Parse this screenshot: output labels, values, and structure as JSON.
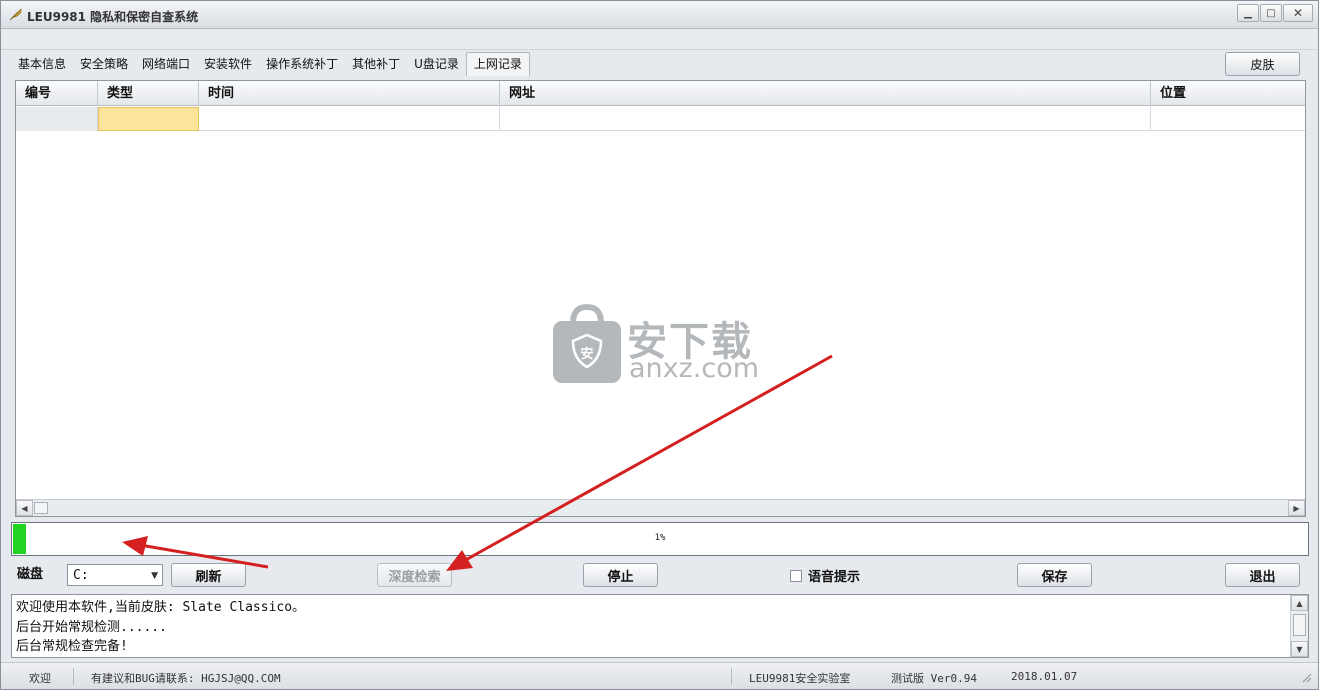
{
  "window": {
    "title": "LEU9981 隐私和保密自查系统",
    "controls": {
      "minimize": "▁",
      "maximize": "□",
      "close": "✕"
    }
  },
  "tabs": [
    {
      "label": "基本信息"
    },
    {
      "label": "安全策略"
    },
    {
      "label": "网络端口"
    },
    {
      "label": "安装软件"
    },
    {
      "label": "操作系统补丁"
    },
    {
      "label": "其他补丁"
    },
    {
      "label": "U盘记录"
    },
    {
      "label": "上网记录",
      "active": true
    }
  ],
  "skin_button": "皮肤",
  "table": {
    "columns": [
      "编号",
      "类型",
      "时间",
      "网址",
      "位置"
    ],
    "rows": [
      [
        "",
        "",
        "",
        "",
        ""
      ]
    ]
  },
  "watermark": {
    "cn": "安下载",
    "en": "anxz.com",
    "badge": "安"
  },
  "progress": {
    "value": 0.01,
    "label": "1%"
  },
  "controls": {
    "disk_label": "磁盘",
    "disk_value": "C:",
    "refresh": "刷新",
    "deep_search": "深度检索",
    "stop": "停止",
    "voice_prompt": "语音提示",
    "voice_checked": false,
    "save": "保存",
    "exit": "退出"
  },
  "log": {
    "lines": [
      "欢迎使用本软件,当前皮肤: Slate Classico。",
      "后台开始常规检测......",
      "后台常规检查完备!"
    ]
  },
  "statusbar": {
    "welcome": "欢迎",
    "contact": "有建议和BUG请联系: HGJSJ@QQ.COM",
    "lab": "LEU9981安全实验室",
    "edition": "测试版 Ver0.94",
    "date": "2018.01.07"
  },
  "colors": {
    "progress_fill": "#22d322",
    "focus_cell": "#fbe59c",
    "annotation_arrow": "#d42020"
  }
}
